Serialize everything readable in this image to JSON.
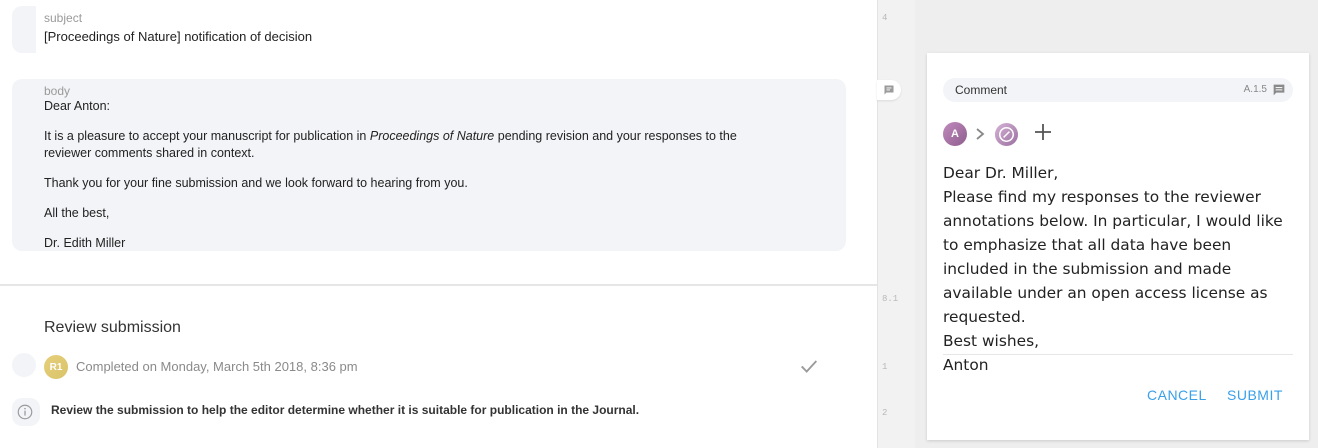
{
  "email": {
    "subject_label": "subject",
    "subject_value": "[Proceedings of Nature] notification of decision",
    "body_label": "body",
    "body_greeting": "Dear Anton:",
    "body_para1_pre": "It is a pleasure to accept your manuscript for publication in ",
    "body_para1_journal": "Proceedings of Nature",
    "body_para1_post": " pending revision and your responses to the",
    "body_para1_line2": "reviewer comments shared in context.",
    "body_para2": "Thank you for your fine submission and we look forward to hearing from you.",
    "body_closing": "All the best,",
    "body_signature": "Dr. Edith Miller"
  },
  "review": {
    "title": "Review submission",
    "reviewer_badge": "R1",
    "completed_text": "Completed on Monday, March 5th 2018, 8:36 pm",
    "instruction": "Review the submission to help the editor determine whether it is suitable for publication in the Journal."
  },
  "gutter": {
    "numbers": [
      "4",
      "8.1",
      "1",
      "2"
    ]
  },
  "comment_panel": {
    "header_label": "Comment",
    "reference": "A.1.5",
    "author_initial": "A",
    "text": "Dear Dr. Miller,\nPlease find my responses to the reviewer annotations below. In particular, I would like to emphasize that all data have been included in the submission and made available under an open access license as requested.\nBest wishes,\nAnton",
    "cancel_label": "CANCEL",
    "submit_label": "SUBMIT"
  },
  "colors": {
    "accent": "#3aa0e8",
    "card_bg": "#f2f4f7"
  },
  "icons": [
    "info-icon",
    "checkmark-icon",
    "comment-icon",
    "chevron-right-icon",
    "plus-icon",
    "badge-icon"
  ]
}
